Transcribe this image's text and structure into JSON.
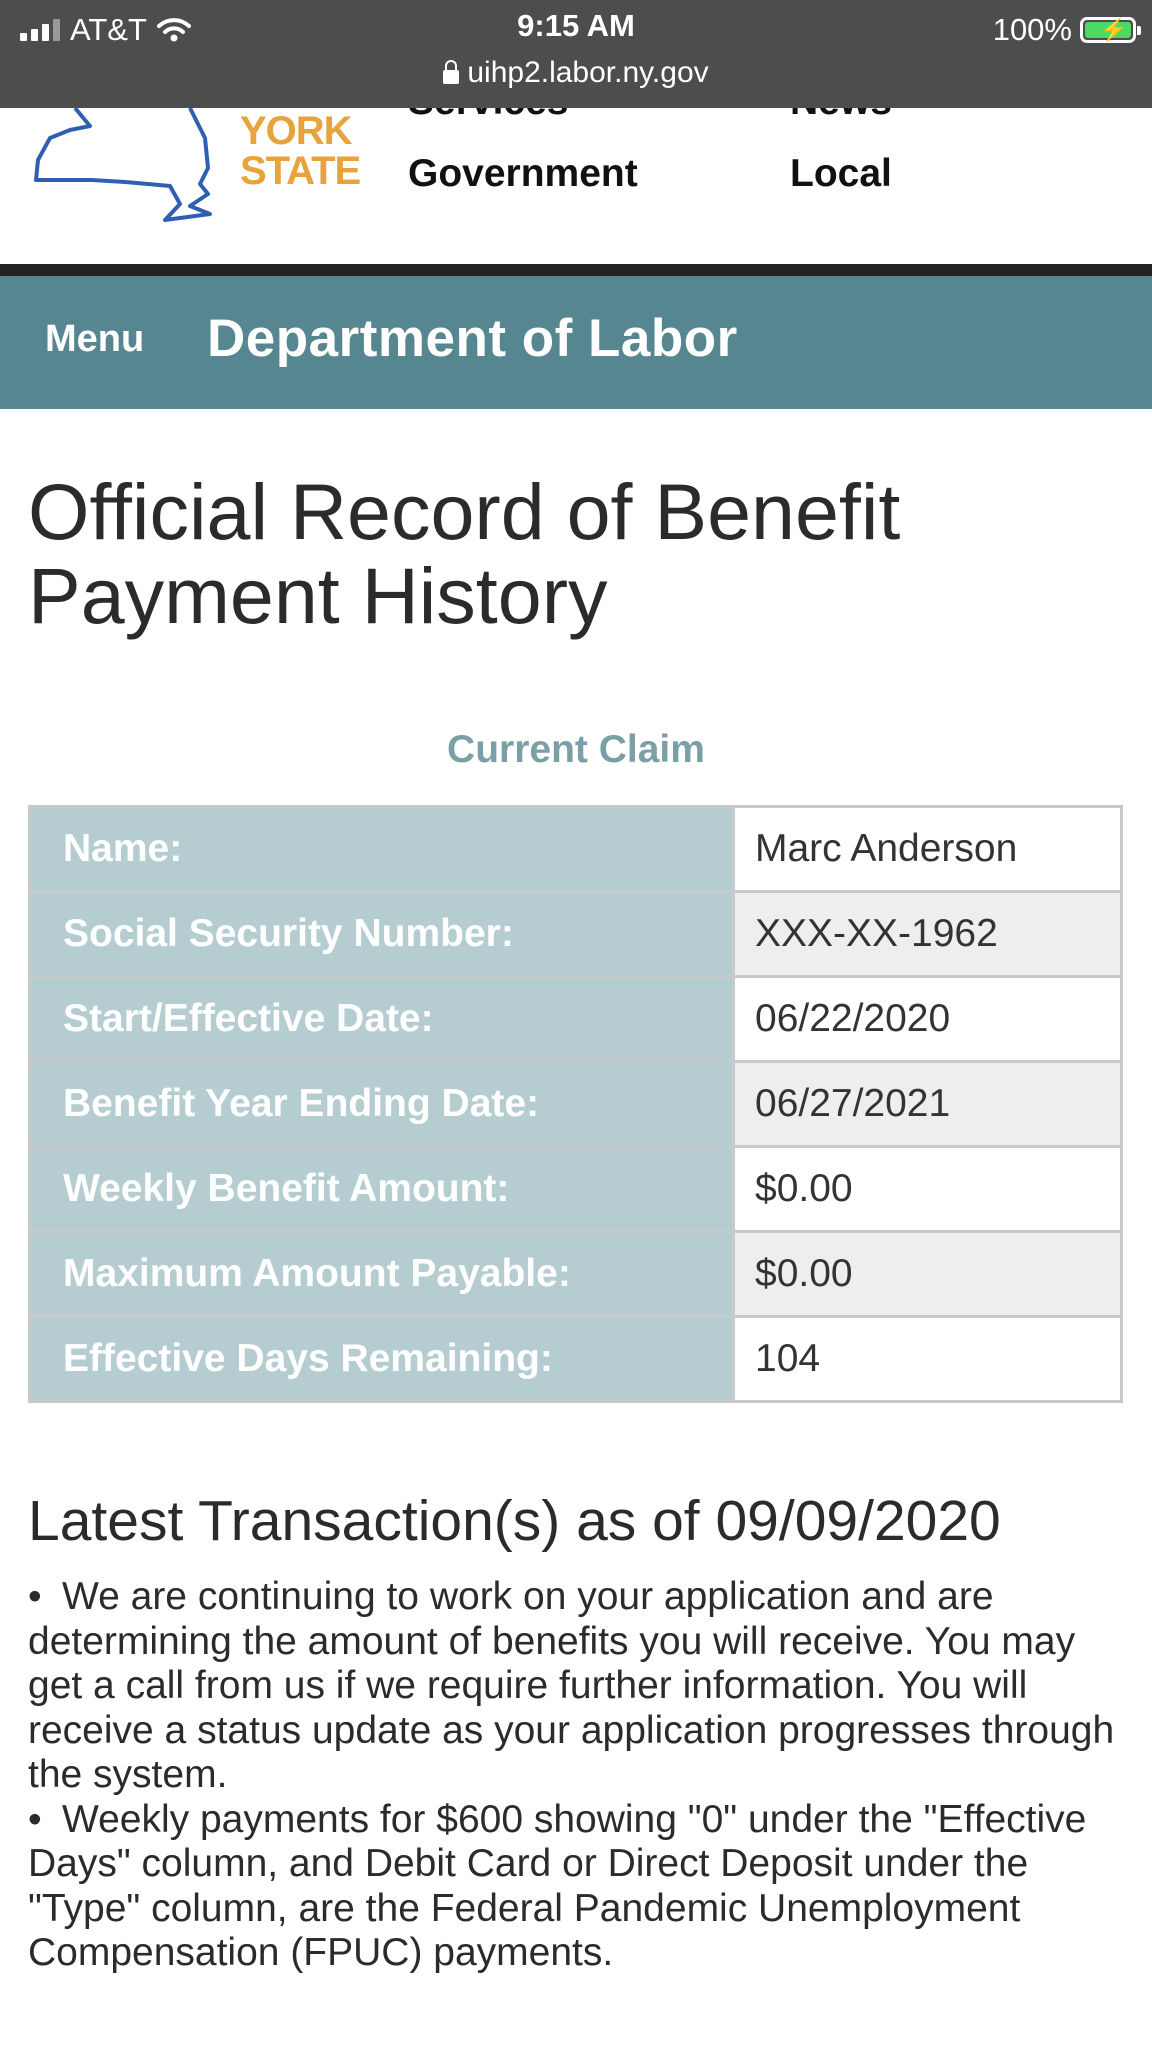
{
  "status_bar": {
    "carrier": "AT&T",
    "time": "9:15 AM",
    "battery_percent": "100%",
    "url": "uihp2.labor.ny.gov"
  },
  "header": {
    "logo": {
      "line1": "YORK",
      "line2": "STATE"
    },
    "top_nav": [
      "Services",
      "News",
      "Government",
      "Local"
    ]
  },
  "nav": {
    "menu_label": "Menu",
    "department_title": "Department of Labor"
  },
  "page": {
    "title": "Official Record of Benefit Payment History",
    "section_heading": "Current Claim"
  },
  "claim": {
    "rows": [
      {
        "label": "Name:",
        "value": "Marc Anderson"
      },
      {
        "label": "Social Security Number:",
        "value": "XXX-XX-1962"
      },
      {
        "label": "Start/Effective Date:",
        "value": "06/22/2020"
      },
      {
        "label": "Benefit Year Ending Date:",
        "value": "06/27/2021"
      },
      {
        "label": "Weekly Benefit Amount:",
        "value": "$0.00"
      },
      {
        "label": "Maximum Amount Payable:",
        "value": "$0.00"
      },
      {
        "label": "Effective Days Remaining:",
        "value": "104"
      }
    ]
  },
  "transactions": {
    "heading": "Latest Transaction(s) as of 09/09/2020",
    "items": [
      "We are continuing to work on your application and are determining the amount of benefits you will receive. You may get a call from us if we require further information. You will receive a status update as your application progresses through the system.",
      "Weekly payments for $600 showing \"0\" under the \"Effective Days\" column, and Debit Card or Direct Deposit under the \"Type\" column, are the Federal Pandemic Unemployment Compensation (FPUC) payments."
    ]
  },
  "colors": {
    "status_bar_bg": "#4d4d4d",
    "nav_bg": "#568791",
    "table_label_bg": "#b5cdd0",
    "section_heading": "#7b9fa6",
    "logo_orange": "#e8a33d",
    "logo_blue": "#2f5fb0"
  },
  "icons": [
    "signal-bars-icon",
    "wifi-icon",
    "battery-charging-icon",
    "lock-icon",
    "ny-state-map-icon"
  ]
}
